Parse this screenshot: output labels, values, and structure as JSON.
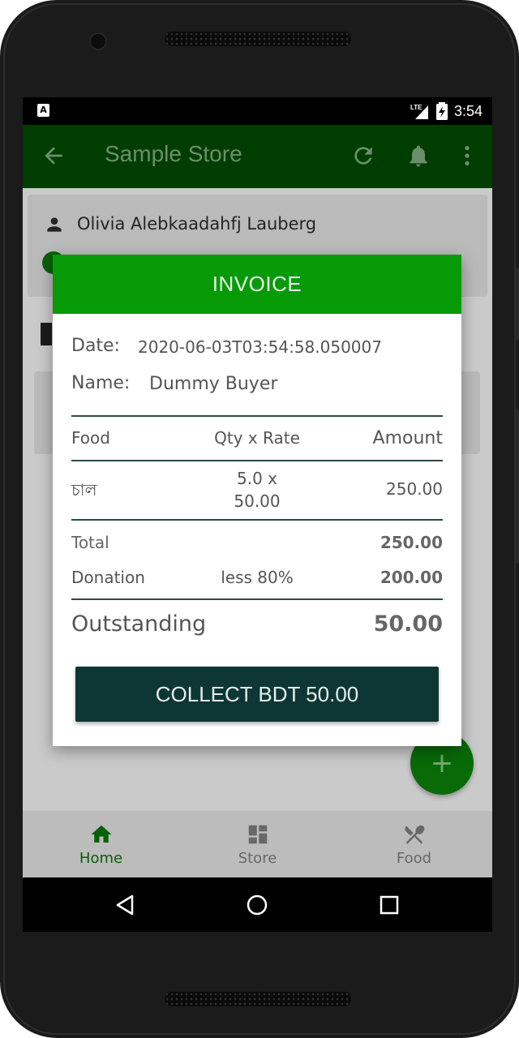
{
  "status_bar": {
    "notification_glyph": "A",
    "network": "LTE",
    "time": "3:54"
  },
  "app_bar": {
    "title": "Sample Store",
    "icons": [
      "back-arrow-icon",
      "refresh-icon",
      "bell-icon",
      "more-vert-icon"
    ]
  },
  "background": {
    "customer_name": "Olivia Alebkaadahfj Lauberg"
  },
  "dialog": {
    "title": "INVOICE",
    "date_label": "Date:",
    "date_value": "2020-06-03T03:54:58.050007",
    "name_label": "Name:",
    "name_value": "Dummy Buyer",
    "headers": {
      "food": "Food",
      "qty_rate": "Qty x Rate",
      "amount": "Amount"
    },
    "items": [
      {
        "food": "চাল",
        "qty_line": "5.0 x",
        "rate_line": "50.00",
        "amount": "250.00"
      }
    ],
    "total_label": "Total",
    "total_value": "250.00",
    "donation_label": "Donation",
    "donation_note": "less 80%",
    "donation_value": "200.00",
    "outstanding_label": "Outstanding",
    "outstanding_value": "50.00",
    "collect_button": "COLLECT BDT 50.00"
  },
  "fab": {
    "icon": "plus-icon"
  },
  "bottom_nav": {
    "items": [
      {
        "label": "Home",
        "icon": "home-icon",
        "active": true
      },
      {
        "label": "Store",
        "icon": "dashboard-icon",
        "active": false
      },
      {
        "label": "Food",
        "icon": "fork-knife-icon",
        "active": false
      }
    ]
  },
  "colors": {
    "app_bar": "#003d00",
    "dialog_header": "#069b06",
    "button": "#0d3734",
    "active_nav": "#0a6e0a"
  }
}
